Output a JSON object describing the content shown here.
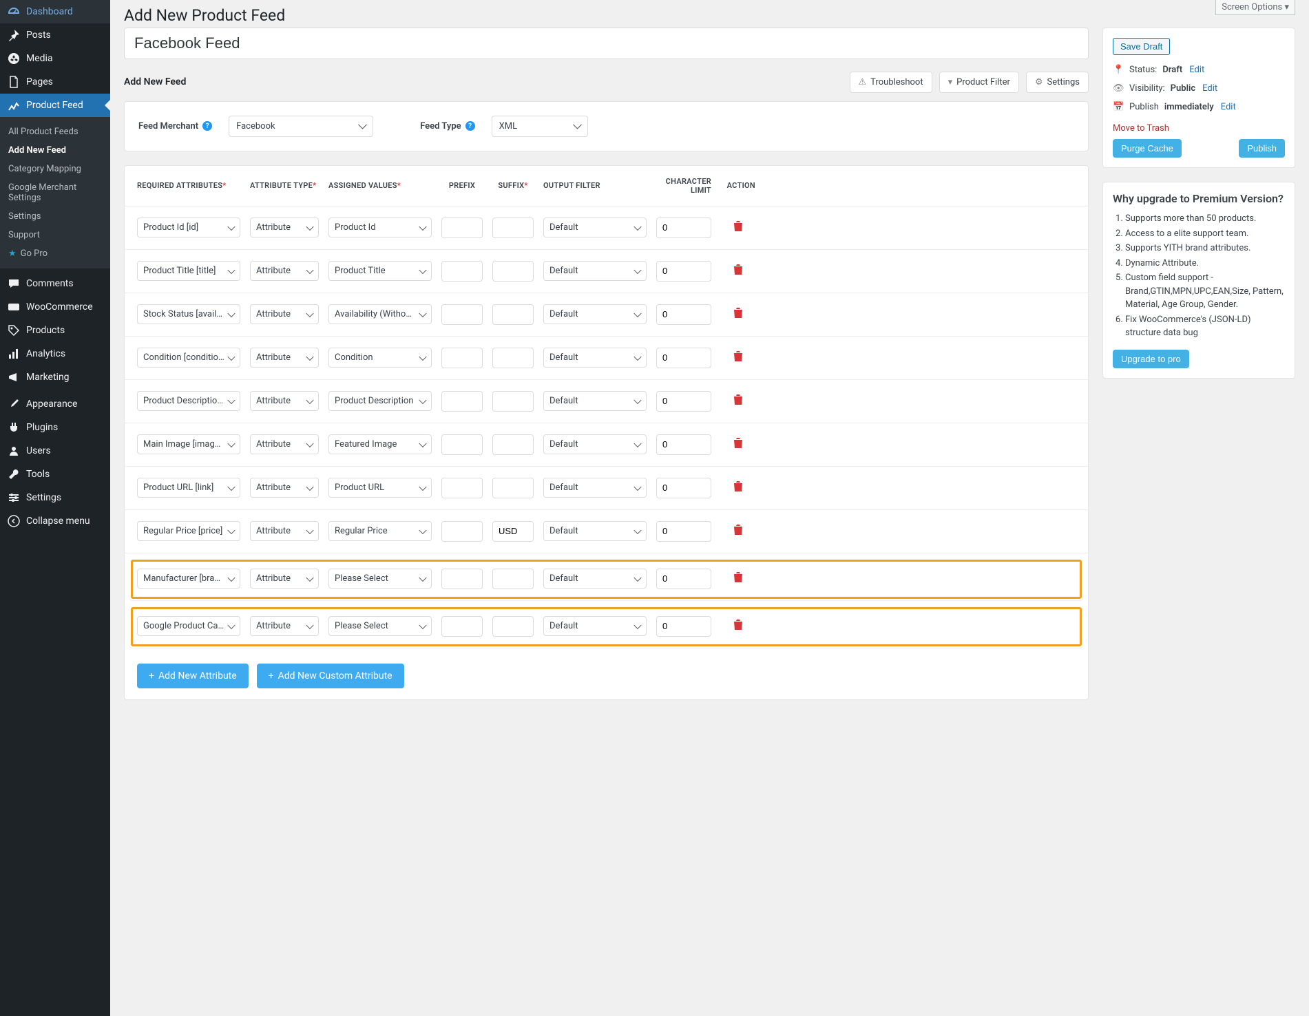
{
  "screen_options": "Screen Options ▾",
  "sidebar": {
    "items": [
      {
        "icon": "dashboard",
        "label": "Dashboard"
      },
      {
        "icon": "pin",
        "label": "Posts"
      },
      {
        "icon": "media",
        "label": "Media"
      },
      {
        "icon": "page",
        "label": "Pages"
      },
      {
        "icon": "chart",
        "label": "Product Feed",
        "active": true
      },
      {
        "icon": "comment",
        "label": "Comments"
      },
      {
        "icon": "woo",
        "label": "WooCommerce"
      },
      {
        "icon": "tag",
        "label": "Products"
      },
      {
        "icon": "analytics",
        "label": "Analytics"
      },
      {
        "icon": "megaphone",
        "label": "Marketing"
      },
      {
        "icon": "brush",
        "label": "Appearance"
      },
      {
        "icon": "plugin",
        "label": "Plugins"
      },
      {
        "icon": "user",
        "label": "Users"
      },
      {
        "icon": "tool",
        "label": "Tools"
      },
      {
        "icon": "settings",
        "label": "Settings"
      },
      {
        "icon": "collapse",
        "label": "Collapse menu"
      }
    ],
    "submenu": [
      {
        "label": "All Product Feeds"
      },
      {
        "label": "Add New Feed",
        "current": true
      },
      {
        "label": "Category Mapping"
      },
      {
        "label": "Google Merchant Settings"
      },
      {
        "label": "Settings"
      },
      {
        "label": "Support"
      },
      {
        "label": "Go Pro",
        "star": true
      }
    ]
  },
  "page": {
    "title": "Add New Product Feed",
    "feed_title": "Facebook Feed",
    "section_title": "Add New Feed",
    "troubleshoot": "Troubleshoot",
    "product_filter": "Product Filter",
    "settings": "Settings"
  },
  "merchant": {
    "feed_merchant_label": "Feed Merchant",
    "feed_merchant_value": "Facebook",
    "feed_type_label": "Feed Type",
    "feed_type_value": "XML"
  },
  "headers": {
    "required": "REQUIRED ATTRIBUTES",
    "type": "ATTRIBUTE TYPE",
    "assigned": "ASSIGNED VALUES",
    "prefix": "PREFIX",
    "suffix": "SUFFIX",
    "output": "OUTPUT FILTER",
    "limit": "CHARACTER LIMIT",
    "action": "ACTION"
  },
  "rows": [
    {
      "attr": "Product Id [id]",
      "type": "Attribute",
      "assigned": "Product Id",
      "prefix": "",
      "suffix": "",
      "filter": "Default",
      "limit": "0",
      "highlight": false
    },
    {
      "attr": "Product Title [title]",
      "type": "Attribute",
      "assigned": "Product Title",
      "prefix": "",
      "suffix": "",
      "filter": "Default",
      "limit": "0",
      "highlight": false
    },
    {
      "attr": "Stock Status [availability]",
      "type": "Attribute",
      "assigned": "Availability (Without Underscore)",
      "prefix": "",
      "suffix": "",
      "filter": "Default",
      "limit": "0",
      "highlight": false
    },
    {
      "attr": "Condition [condition]",
      "type": "Attribute",
      "assigned": "Condition",
      "prefix": "",
      "suffix": "",
      "filter": "Default",
      "limit": "0",
      "highlight": false
    },
    {
      "attr": "Product Description [description]",
      "type": "Attribute",
      "assigned": "Product Description",
      "prefix": "",
      "suffix": "",
      "filter": "Default",
      "limit": "0",
      "highlight": false
    },
    {
      "attr": "Main Image [image_link]",
      "type": "Attribute",
      "assigned": "Featured Image",
      "prefix": "",
      "suffix": "",
      "filter": "Default",
      "limit": "0",
      "highlight": false
    },
    {
      "attr": "Product URL [link]",
      "type": "Attribute",
      "assigned": "Product URL",
      "prefix": "",
      "suffix": "",
      "filter": "Default",
      "limit": "0",
      "highlight": false
    },
    {
      "attr": "Regular Price [price]",
      "type": "Attribute",
      "assigned": "Regular Price",
      "prefix": "",
      "suffix": "USD",
      "filter": "Default",
      "limit": "0",
      "highlight": false
    },
    {
      "attr": "Manufacturer [brand]",
      "type": "Attribute",
      "assigned": "Please Select",
      "prefix": "",
      "suffix": "",
      "filter": "Default",
      "limit": "0",
      "highlight": true
    },
    {
      "attr": "Google Product Category [google_product_category]",
      "type": "Attribute",
      "assigned": "Please Select",
      "prefix": "",
      "suffix": "",
      "filter": "Default",
      "limit": "0",
      "highlight": true
    }
  ],
  "buttons": {
    "add_attr": "Add New Attribute",
    "add_custom": "Add New Custom Attribute"
  },
  "publish_box": {
    "save_draft": "Save Draft",
    "status_label": "Status:",
    "status_value": "Draft",
    "visibility_label": "Visibility:",
    "visibility_value": "Public",
    "publish_label": "Publish",
    "publish_value": "immediately",
    "edit": "Edit",
    "trash": "Move to Trash",
    "purge": "Purge Cache",
    "publish_btn": "Publish"
  },
  "upgrade": {
    "title": "Why upgrade to Premium Version?",
    "items": [
      "Supports more than 50 products.",
      "Access to a elite support team.",
      "Supports YITH brand attributes.",
      "Dynamic Attribute.",
      "Custom field support - Brand,GTIN,MPN,UPC,EAN,Size, Pattern, Material, Age Group, Gender.",
      "Fix WooCommerce's (JSON-LD) structure data bug"
    ],
    "btn": "Upgrade to pro"
  }
}
